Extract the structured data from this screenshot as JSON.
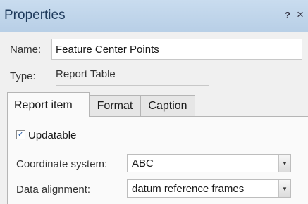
{
  "window": {
    "title": "Properties",
    "help_label": "?",
    "close_label": "×"
  },
  "fields": {
    "name_label": "Name:",
    "name_value": "Feature Center Points",
    "type_label": "Type:",
    "type_value": "Report Table"
  },
  "tabs": [
    {
      "label": "Report item",
      "active": true
    },
    {
      "label": "Format",
      "active": false
    },
    {
      "label": "Caption",
      "active": false
    }
  ],
  "report_item": {
    "updatable_label": "Updatable",
    "updatable_checked": true,
    "coordinate_system_label": "Coordinate system:",
    "coordinate_system_value": "ABC",
    "data_alignment_label": "Data alignment:",
    "data_alignment_value": "datum reference frames"
  }
}
